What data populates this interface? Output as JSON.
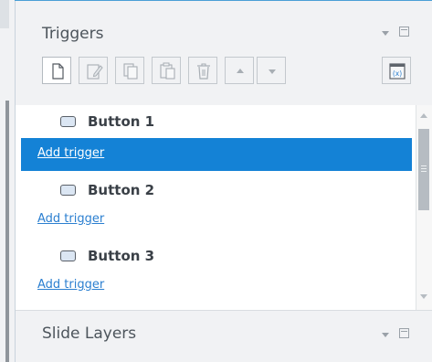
{
  "triggers_panel": {
    "title": "Triggers",
    "toolbar": {
      "new_icon": "new-document-icon",
      "edit_icon": "edit-icon",
      "copy_icon": "copy-icon",
      "paste_icon": "paste-icon",
      "delete_icon": "trash-icon",
      "move_up_icon": "arrow-up-icon",
      "move_down_icon": "arrow-down-icon",
      "variables_icon": "variables-icon",
      "variables_glyph": "(x)"
    },
    "items": [
      {
        "label": "Button 1",
        "trigger_link": "Add trigger",
        "selected": true
      },
      {
        "label": "Button 2",
        "trigger_link": "Add trigger",
        "selected": false
      },
      {
        "label": "Button 3",
        "trigger_link": "Add trigger",
        "selected": false
      }
    ]
  },
  "slide_layers_panel": {
    "title": "Slide Layers"
  },
  "colors": {
    "accent": "#1482d6",
    "link": "#2b7fd0",
    "panel_bg": "#f1f2f4",
    "list_bg": "#ffffff",
    "title_text": "#4d555c"
  }
}
